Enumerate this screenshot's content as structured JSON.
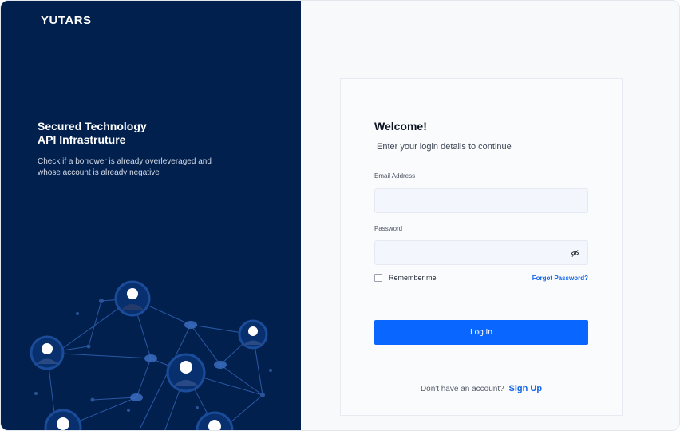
{
  "brand": {
    "name": "YUTARS"
  },
  "hero": {
    "title_line1": "Secured Technology",
    "title_line2": "API Infrastruture",
    "subtitle": "Check if a borrower is already overleveraged and whose account is already negative"
  },
  "login": {
    "heading": "Welcome!",
    "subheading": "Enter your login details to continue",
    "email_label": "Email Address",
    "email_value": "",
    "email_placeholder": "",
    "password_label": "Password",
    "password_value": "",
    "password_placeholder": "",
    "remember_label": "Remember me",
    "remember_checked": false,
    "forgot_label": "Forgot Password?",
    "submit_label": "Log In",
    "signup_prompt": "Don't have an account?",
    "signup_label": "Sign Up"
  },
  "icons": {
    "password_toggle": "eye-off-icon",
    "checkbox": "checkbox-unchecked"
  },
  "colors": {
    "sidebar_bg": "#02204d",
    "primary": "#0966ff",
    "link": "#1565e8",
    "field_bg": "#f3f6fd"
  }
}
